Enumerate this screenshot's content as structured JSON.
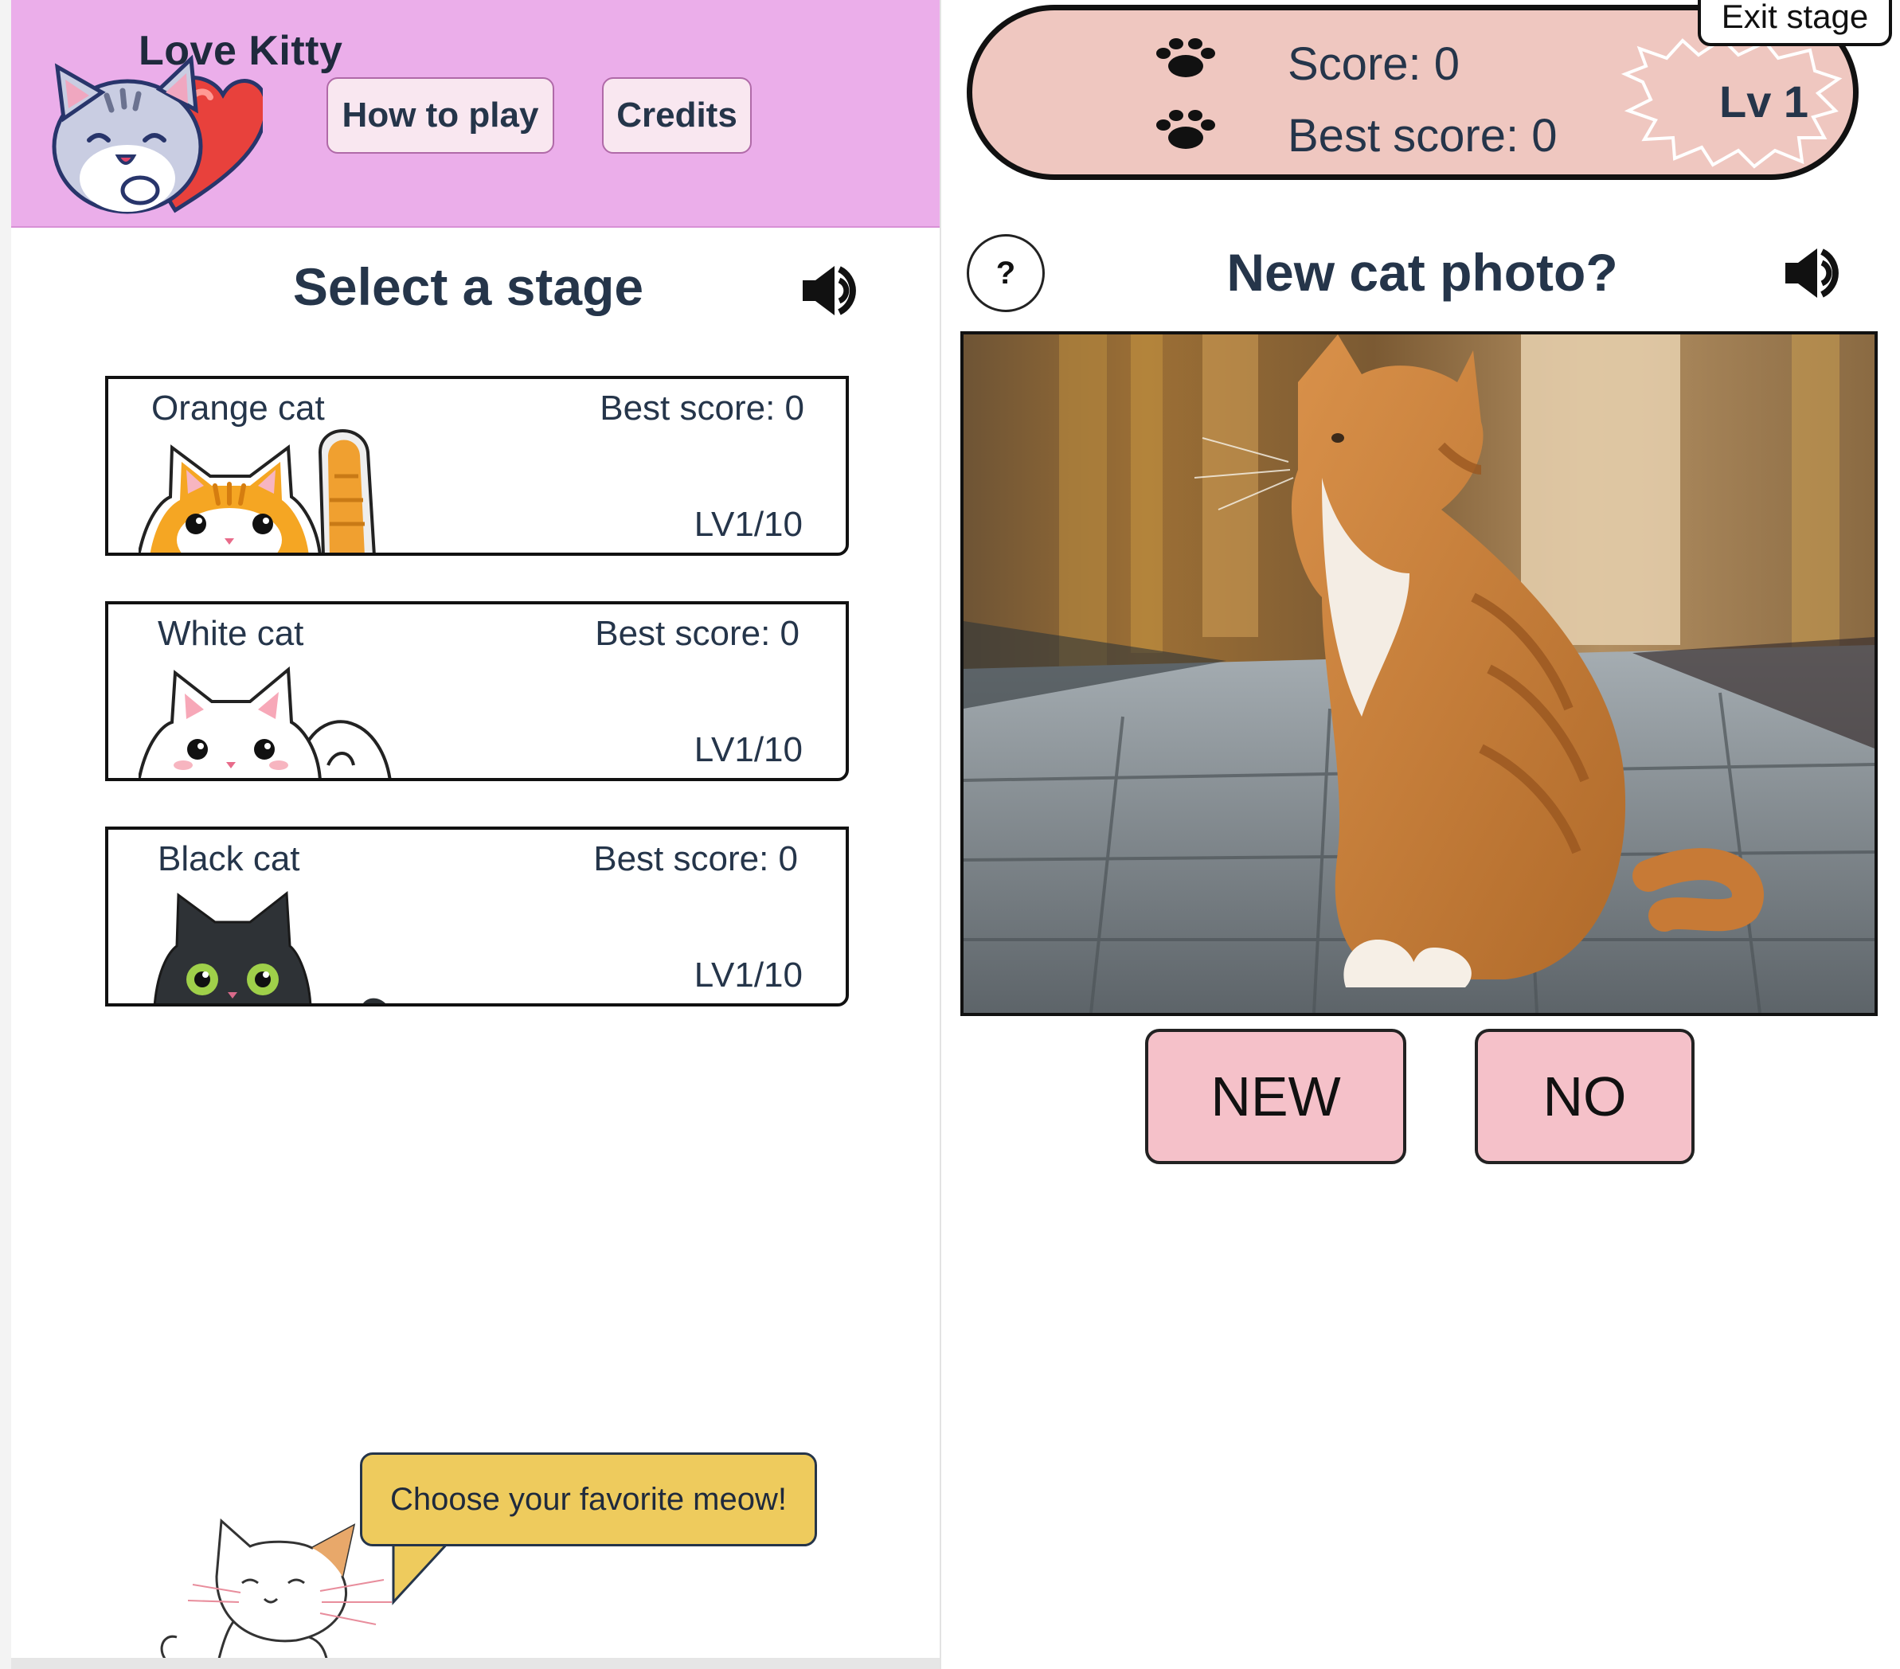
{
  "left": {
    "header": {
      "title": "Love Kitty",
      "nav": [
        {
          "label": "How to play"
        },
        {
          "label": "Credits"
        }
      ]
    },
    "section_title": "Select a stage",
    "stages": [
      {
        "name": "Orange cat",
        "best": "Best score: 0",
        "level": "LV1/10",
        "icon": "orange-cat-icon"
      },
      {
        "name": "White cat",
        "best": "Best score: 0",
        "level": "LV1/10",
        "icon": "white-cat-icon"
      },
      {
        "name": "Black cat",
        "best": "Best score: 0",
        "level": "LV1/10",
        "icon": "black-cat-icon"
      }
    ],
    "speech_bubble": "Choose your favorite meow!"
  },
  "right": {
    "score": "Score: 0",
    "best_score": "Best score: 0",
    "level": "Lv 1",
    "exit_label": "Exit stage",
    "help_label": "?",
    "question": "New cat photo?",
    "buttons": {
      "new": "NEW",
      "no": "NO"
    }
  },
  "colors": {
    "header_bg": "#ebaeea",
    "score_pill_bg": "#efc7c0",
    "answer_button_bg": "#f5c1c9",
    "bubble_bg": "#eecb5d",
    "text": "#25354a"
  }
}
